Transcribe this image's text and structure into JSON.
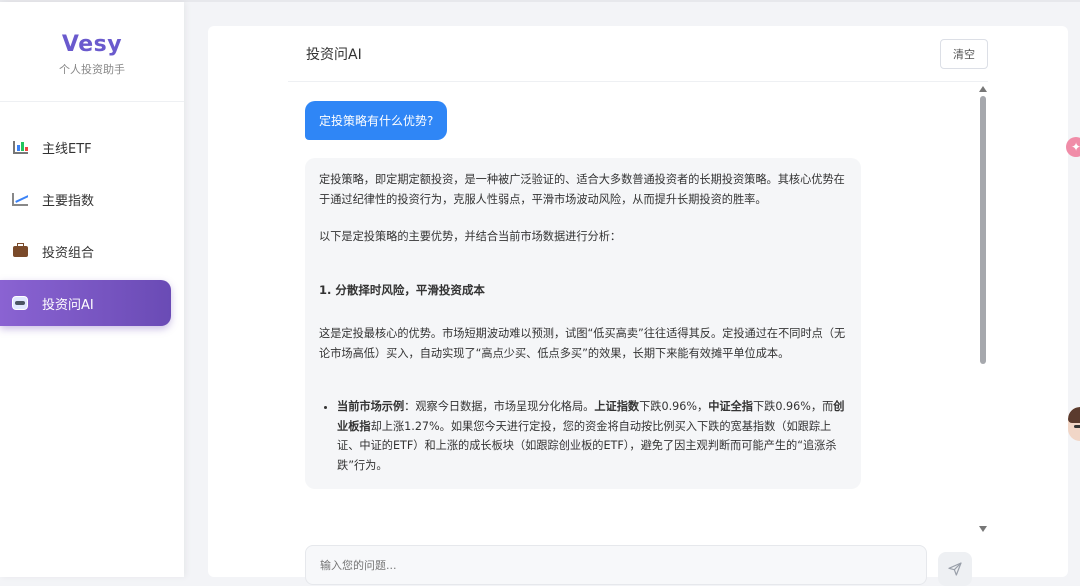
{
  "brand": {
    "name": "Vesy",
    "subtitle": "个人投资助手"
  },
  "sidebar": {
    "items": [
      {
        "label": "主线ETF",
        "icon": "bar-chart-icon",
        "active": false
      },
      {
        "label": "主要指数",
        "icon": "line-chart-icon",
        "active": false
      },
      {
        "label": "投资组合",
        "icon": "briefcase-icon",
        "active": false
      },
      {
        "label": "投资问AI",
        "icon": "robot-icon",
        "active": true
      }
    ]
  },
  "chat": {
    "title": "投资问AI",
    "clear_label": "清空",
    "user_message": "定投策略有什么优势?",
    "ai": {
      "p1": "定投策略，即定期定额投资，是一种被广泛验证的、适合大多数普通投资者的长期投资策略。其核心优势在于通过纪律性的投资行为，克服人性弱点，平滑市场波动风险，从而提升长期投资的胜率。",
      "p2": "以下是定投策略的主要优势，并结合当前市场数据进行分析：",
      "h1": "1. 分散择时风险，平滑投资成本",
      "p3": "这是定投最核心的优势。市场短期波动难以预测，试图“低买高卖”往往适得其反。定投通过在不同时点（无论市场高低）买入，自动实现了“高点少买、低点多买”的效果，长期下来能有效摊平单位成本。",
      "li": {
        "b1": "当前市场示例",
        "t1": "：观察今日数据，市场呈现分化格局。",
        "b2": "上证指数",
        "t2": "下跌0.96%，",
        "b3": "中证全指",
        "t3": "下跌0.96%，而",
        "b4": "创业板指",
        "t4": "却上涨1.27%。如果您今天进行定投，您的资金将自动按比例买入下跌的宽基指数（如跟踪上证、中证的ETF）和上涨的成长板块（如跟踪创业板的ETF），避免了因主观判断而可能产生的“追涨杀跌”行为。"
      }
    },
    "input_placeholder": "输入您的问题..."
  },
  "colors": {
    "accent": "#6a4bb5",
    "user_bubble": "#2f86f6"
  }
}
